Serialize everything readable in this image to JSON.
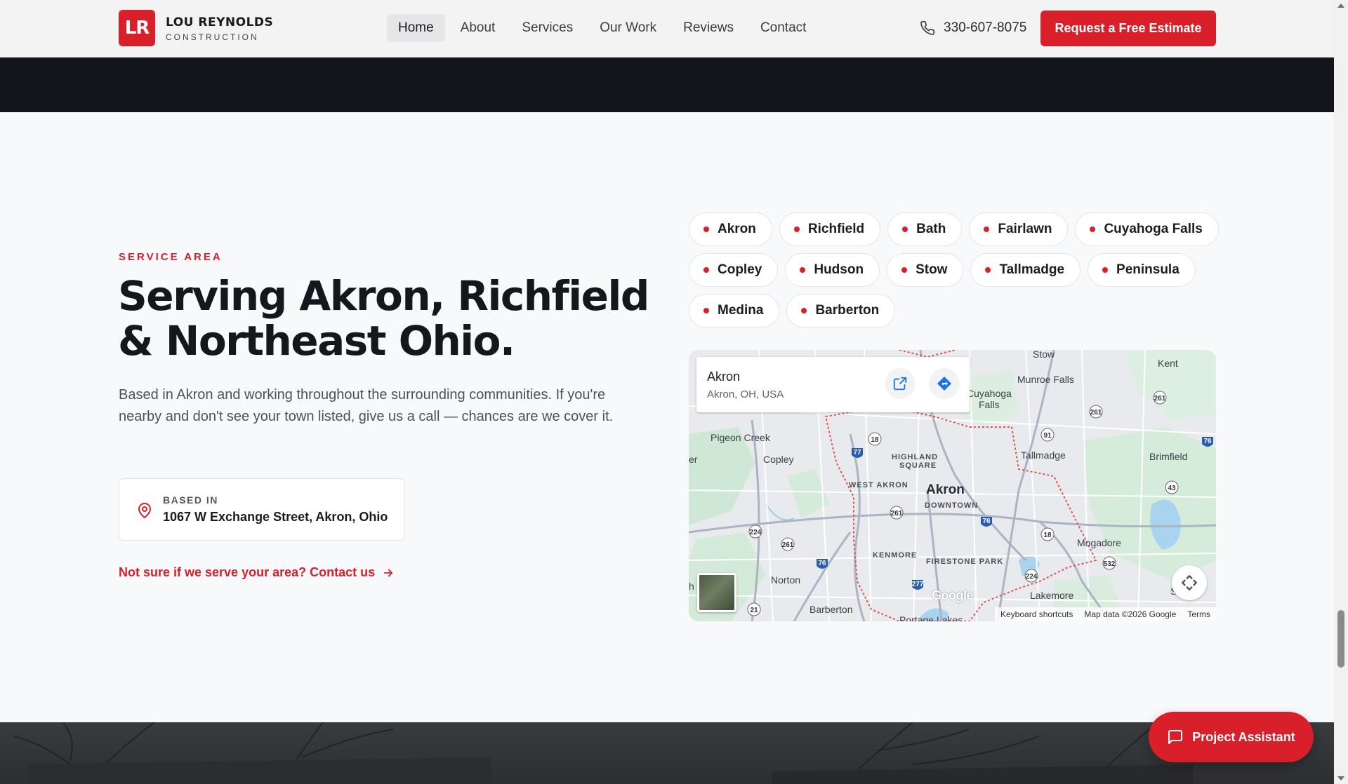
{
  "header": {
    "logo_mark": "LR",
    "logo_name": "LOU REYNOLDS",
    "logo_sub": "CONSTRUCTION",
    "nav": [
      {
        "label": "Home",
        "active": true
      },
      {
        "label": "About",
        "active": false
      },
      {
        "label": "Services",
        "active": false
      },
      {
        "label": "Our Work",
        "active": false
      },
      {
        "label": "Reviews",
        "active": false
      },
      {
        "label": "Contact",
        "active": false
      }
    ],
    "phone": "330-607-8075",
    "cta": "Request a Free Estimate"
  },
  "service": {
    "eyebrow": "SERVICE AREA",
    "headline_line1": "Serving Akron, Richfield",
    "headline_line2": "& Northeast Ohio.",
    "description": "Based in Akron and working throughout the surrounding communities. If you're nearby and don't see your town listed, give us a call — chances are we cover it.",
    "based_label": "BASED IN",
    "based_value": "1067 W Exchange Street, Akron, Ohio",
    "contact_link": "Not sure if we serve your area? Contact us"
  },
  "chips": [
    "Akron",
    "Richfield",
    "Bath",
    "Fairlawn",
    "Cuyahoga Falls",
    "Copley",
    "Hudson",
    "Stow",
    "Tallmadge",
    "Peninsula",
    "Medina",
    "Barberton"
  ],
  "map": {
    "card_title": "Akron",
    "card_sub": "Akron, OH, USA",
    "labels": {
      "stow": "Stow",
      "kent": "Kent",
      "munroe": "Munroe Falls",
      "cuyahoga1": "Cuyahoga",
      "cuyahoga2": "Falls",
      "pigeon": "Pigeon Creek",
      "copley": "Copley",
      "highland1": "HIGHLAND",
      "highland2": "SQUARE",
      "tallmadge": "Tallmadge",
      "brimfield": "Brimfield",
      "westakron": "WEST AKRON",
      "akron": "Akron",
      "downtown": "DOWNTOWN",
      "kenmore": "KENMORE",
      "firestone": "FIRESTONE PARK",
      "mogadore": "Mogadore",
      "norton": "Norton",
      "barberton": "Barberton",
      "lakemore": "Lakemore",
      "portage": "Portage Lakes",
      "suffield": "Suff",
      "edge_er": "er",
      "edge_h": "h"
    },
    "google": "Google",
    "attrib": [
      "Keyboard shortcuts",
      "Map data ©2026 Google",
      "Terms"
    ]
  },
  "assistant": "Project Assistant",
  "colors": {
    "brand": "#d81f2a",
    "dark": "#13151a"
  }
}
